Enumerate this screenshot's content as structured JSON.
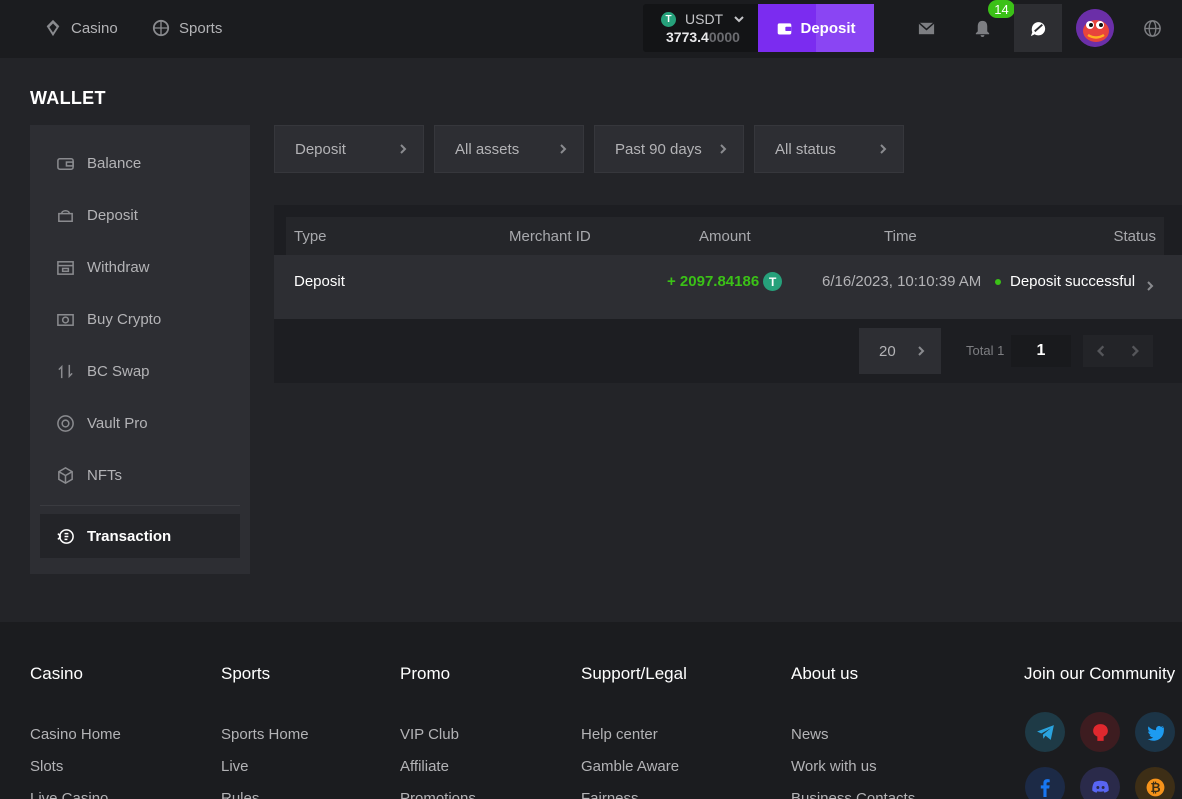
{
  "header": {
    "nav": [
      {
        "label": "Casino"
      },
      {
        "label": "Sports"
      }
    ],
    "wallet": {
      "currency": "USDT",
      "coin_letter": "T",
      "balance_main": "3773.4",
      "balance_fade": "0000"
    },
    "deposit_label": "Deposit",
    "notification_count": "14"
  },
  "page": {
    "title": "WALLET"
  },
  "sidebar": {
    "items": [
      {
        "label": "Balance"
      },
      {
        "label": "Deposit"
      },
      {
        "label": "Withdraw"
      },
      {
        "label": "Buy Crypto"
      },
      {
        "label": "BC Swap"
      },
      {
        "label": "Vault Pro"
      },
      {
        "label": "NFTs"
      },
      {
        "label": "Transaction"
      }
    ]
  },
  "filters": [
    {
      "label": "Deposit"
    },
    {
      "label": "All assets"
    },
    {
      "label": "Past 90 days"
    },
    {
      "label": "All status"
    }
  ],
  "table": {
    "columns": [
      "Type",
      "Merchant ID",
      "Amount",
      "Time",
      "Status"
    ],
    "rows": [
      {
        "type": "Deposit",
        "merchant_id": "",
        "amount": "+ 2097.84186",
        "coin_letter": "T",
        "time": "6/16/2023, 10:10:39 AM",
        "status": "Deposit successful"
      }
    ]
  },
  "pagination": {
    "page_size": "20",
    "total": "Total 1",
    "current_page": "1"
  },
  "footer": {
    "columns": [
      {
        "title": "Casino",
        "links": [
          "Casino Home",
          "Slots",
          "Live Casino"
        ]
      },
      {
        "title": "Sports",
        "links": [
          "Sports Home",
          "Live",
          "Rules"
        ]
      },
      {
        "title": "Promo",
        "links": [
          "VIP Club",
          "Affiliate",
          "Promotions"
        ]
      },
      {
        "title": "Support/Legal",
        "links": [
          "Help center",
          "Gamble Aware",
          "Fairness"
        ]
      },
      {
        "title": "About us",
        "links": [
          "News",
          "Work with us",
          "Business Contacts"
        ]
      }
    ],
    "community_title": "Join our Community",
    "social_icons": [
      "telegram-icon",
      "github-icon",
      "twitter-icon",
      "facebook-icon",
      "discord-icon",
      "bitcoin-icon"
    ]
  },
  "colors": {
    "accent": "#7b2cf0",
    "success": "#3bc117",
    "tether": "#26a17b",
    "background": "#232428"
  }
}
